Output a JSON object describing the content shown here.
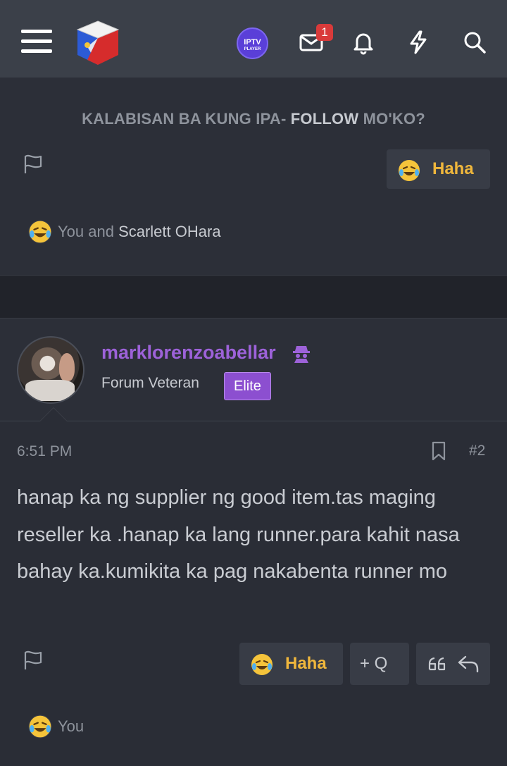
{
  "header": {
    "menu_icon": "hamburger-menu-icon",
    "logo_icon": "site-logo-cube-icon",
    "iptv_label": "IPTV",
    "iptv_sub": "PLAYER",
    "inbox_badge": "1",
    "icons": [
      "envelope-icon",
      "bell-icon",
      "lightning-icon",
      "search-icon"
    ]
  },
  "post1": {
    "follow_text_pre": "KALABISAN BA KUNG IPA- ",
    "follow_text_bold": "FOLLOW",
    "follow_text_post": " MO'KO?",
    "reaction_button": "Haha",
    "reactions_you": "You and ",
    "reactions_other": "Scarlett OHara"
  },
  "post2": {
    "username": "marklorenzoabellar",
    "user_title": "Forum Veteran",
    "user_badge": "Elite",
    "time": "6:51 PM",
    "post_number": "#2",
    "message": "hanap ka ng supplier ng good item.tas maging reseller ka .hanap ka lang runner.para kahit nasa bahay ka.kumikita ka pag nakabenta runner mo",
    "reaction_button": "Haha",
    "multiquote_label": "+ Q",
    "reactions_you": "You"
  },
  "colors": {
    "header_bg": "#3b4049",
    "page_bg": "#2a2d36",
    "username": "#9d62d9",
    "haha": "#f0b73c",
    "elite_badge": "#8c4fd0"
  }
}
